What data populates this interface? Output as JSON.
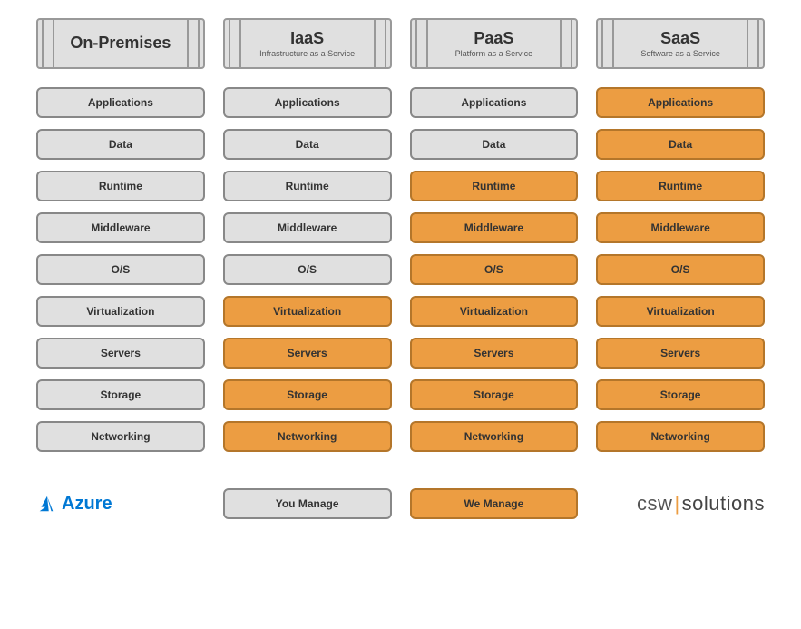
{
  "columns": [
    {
      "title": "On-Premises",
      "subtitle": ""
    },
    {
      "title": "IaaS",
      "subtitle": "Infrastructure as a Service"
    },
    {
      "title": "PaaS",
      "subtitle": "Platform as a Service"
    },
    {
      "title": "SaaS",
      "subtitle": "Software as a Service"
    }
  ],
  "layers": [
    "Applications",
    "Data",
    "Runtime",
    "Middleware",
    "O/S",
    "Virtualization",
    "Servers",
    "Storage",
    "Networking"
  ],
  "management": {
    "On-Premises": [
      "you",
      "you",
      "you",
      "you",
      "you",
      "you",
      "you",
      "you",
      "you"
    ],
    "IaaS": [
      "you",
      "you",
      "you",
      "you",
      "you",
      "we",
      "we",
      "we",
      "we"
    ],
    "PaaS": [
      "you",
      "you",
      "we",
      "we",
      "we",
      "we",
      "we",
      "we",
      "we"
    ],
    "SaaS": [
      "we",
      "we",
      "we",
      "we",
      "we",
      "we",
      "we",
      "we",
      "we"
    ]
  },
  "legend": {
    "you": "You Manage",
    "we": "We Manage"
  },
  "branding": {
    "azure": "Azure",
    "csw_left": "csw",
    "csw_right": "solutions"
  },
  "colors": {
    "you_bg": "#e0e0e0",
    "you_border": "#888888",
    "we_bg": "#ec9d42",
    "we_border": "#b4762a",
    "azure_blue": "#0078d4"
  },
  "chart_data": {
    "type": "table",
    "title": "Cloud Service Model Responsibility Comparison",
    "columns": [
      "On-Premises",
      "IaaS",
      "PaaS",
      "SaaS"
    ],
    "rows": [
      "Applications",
      "Data",
      "Runtime",
      "Middleware",
      "O/S",
      "Virtualization",
      "Servers",
      "Storage",
      "Networking"
    ],
    "values": [
      [
        "You Manage",
        "You Manage",
        "You Manage",
        "We Manage"
      ],
      [
        "You Manage",
        "You Manage",
        "You Manage",
        "We Manage"
      ],
      [
        "You Manage",
        "You Manage",
        "We Manage",
        "We Manage"
      ],
      [
        "You Manage",
        "You Manage",
        "We Manage",
        "We Manage"
      ],
      [
        "You Manage",
        "You Manage",
        "We Manage",
        "We Manage"
      ],
      [
        "You Manage",
        "We Manage",
        "We Manage",
        "We Manage"
      ],
      [
        "You Manage",
        "We Manage",
        "We Manage",
        "We Manage"
      ],
      [
        "You Manage",
        "We Manage",
        "We Manage",
        "We Manage"
      ],
      [
        "You Manage",
        "We Manage",
        "We Manage",
        "We Manage"
      ]
    ],
    "legend": {
      "You Manage": "#e0e0e0",
      "We Manage": "#ec9d42"
    }
  }
}
